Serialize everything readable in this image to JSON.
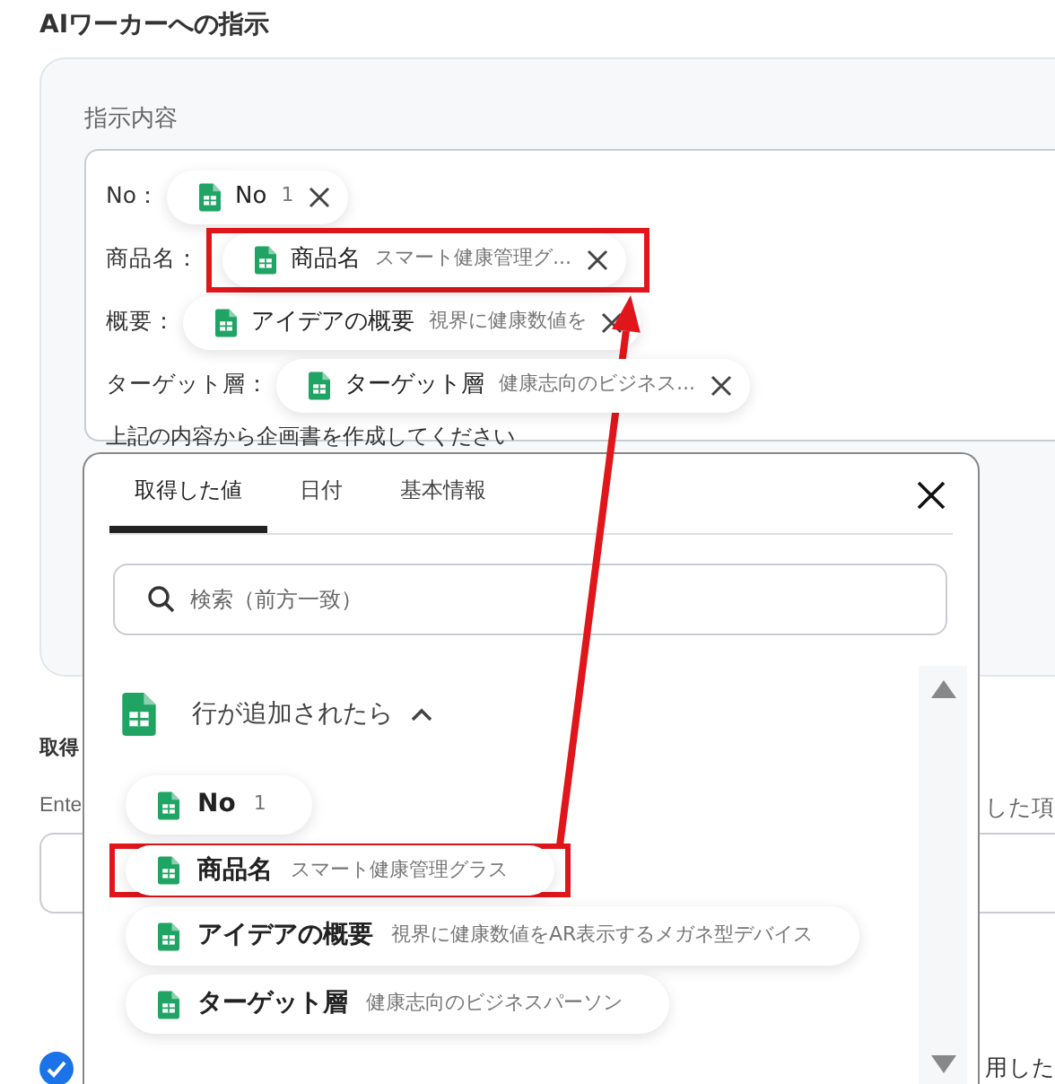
{
  "section_title": "AIワーカーへの指示",
  "instruction_panel": {
    "label": "指示内容",
    "lines": [
      {
        "label": "No：",
        "token": {
          "name": "No",
          "value": "1",
          "highlighted": false
        }
      },
      {
        "label": "商品名：",
        "token": {
          "name": "商品名",
          "value": "スマート健康管理グ...",
          "highlighted": true
        }
      },
      {
        "label": "概要：",
        "token": {
          "name": "アイデアの概要",
          "value": "視界に健康数値を",
          "highlighted": false
        }
      },
      {
        "label": "ターゲット層：",
        "token": {
          "name": "ターゲット層",
          "value": "健康志向のビジネス...",
          "highlighted": false
        }
      }
    ],
    "text": "上記の内容から企画書を作成してください"
  },
  "background_section": {
    "title": "取得",
    "hint_left": "Ente",
    "hint_right": "した項",
    "checkbox": {
      "checked": true
    },
    "note": "用した"
  },
  "popup": {
    "tabs": [
      {
        "label": "取得した値",
        "selected": true
      },
      {
        "label": "日付",
        "selected": false
      },
      {
        "label": "基本情報",
        "selected": false
      }
    ],
    "search": {
      "placeholder": "検索（前方一致）"
    },
    "group": {
      "title": "行が追加されたら",
      "expanded": true,
      "items": [
        {
          "name": "No",
          "value": "1",
          "highlighted": false
        },
        {
          "name": "商品名",
          "value": "スマート健康管理グラス",
          "highlighted": true
        },
        {
          "name": "アイデアの概要",
          "value": "視界に健康数値をAR表示するメガネ型デバイス",
          "highlighted": false
        },
        {
          "name": "ターゲット層",
          "value": "健康志向のビジネスパーソン",
          "highlighted": false
        }
      ]
    }
  }
}
